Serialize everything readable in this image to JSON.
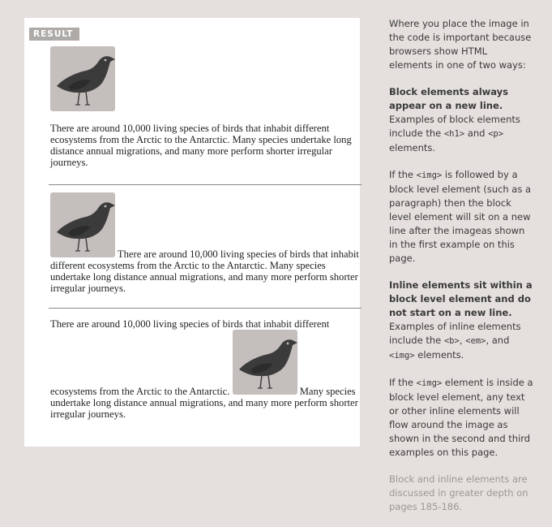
{
  "result_label": "RESULT",
  "bird_image": {
    "icon": "crow-bird-icon",
    "background": "#c4bebc",
    "bird_color": "#3b3b3b"
  },
  "examples": [
    {
      "paragraph": "There are around 10,000 living species of birds that inhabit different ecosystems from the Arctic to the Antarctic. Many species undertake long distance annual migrations, and many more perform shorter irregular journeys."
    },
    {
      "paragraph_after_image": "There are around 10,000 living species of birds that inhabit different ecosystems from the Arctic to the Antarctic. Many species undertake long distance annual migrations, and many more perform shorter irregular journeys."
    },
    {
      "paragraph_before_image": "There are around 10,000 living species of birds that inhabit different ecosystems from the Arctic to the Antarctic.",
      "paragraph_after_image": "Many species undertake long distance annual migrations, and many more perform shorter irregular journeys."
    }
  ],
  "sidebar": {
    "intro": "Where you place the image in the code is important because browsers show HTML elements in one of two ways:",
    "block_heading": "Block elements always appear on a new line.",
    "block_text_1": "Examples of block elements include the",
    "block_code_1": "<h1>",
    "block_text_2": "and",
    "block_code_2": "<p>",
    "block_text_3": "elements.",
    "img_text_1": "If the",
    "img_code": "<img>",
    "img_text_2": "is followed by a block level element (such as  a paragraph) then the block level element will sit on a new line after the imageas shown in the first example on this page.",
    "inline_heading": "Inline elements sit within a block level element and do not start on a new line.",
    "inline_text_1": "Examples of inline elements include the",
    "inline_code_1": "<b>",
    "inline_text_2": ",",
    "inline_code_2": "<em>",
    "inline_text_3": ", and",
    "inline_code_3": "<img>",
    "inline_text_4": "elements.",
    "flow_text_1": "If the",
    "flow_code": "<img>",
    "flow_text_2": "element is inside a block level element, any text or other inline elements will flow around the image as shown in the second and third examples on this page.",
    "note": "Block and inline elements are discussed in greater depth on pages 185-186."
  }
}
